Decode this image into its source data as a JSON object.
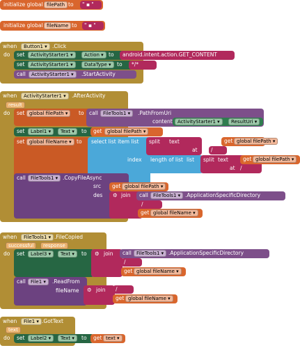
{
  "globals": [
    {
      "keyword": "initialize global",
      "name": "filePath",
      "to": "to",
      "value": " \" ▪ \" "
    },
    {
      "keyword": "initialize global",
      "name": "fileName",
      "to": "to",
      "value": " \" ▪ \" "
    }
  ],
  "ev1": {
    "when": "when",
    "component": "Button1 ▾",
    "event": ".Click",
    "do": "do",
    "set": "set",
    "c1": "ActivityStarter1 ▾",
    "p1": "Action ▾",
    "to": "to",
    "v1": "android.intent.action.GET_CONTENT",
    "c2": "ActivityStarter1 ▾",
    "p2": "DataType ▾",
    "v2": "*/*",
    "call": "call",
    "c3": "ActivityStarter1 ▾",
    "m3": ".StartActivity"
  },
  "ev2": {
    "when": "when",
    "component": "ActivityStarter1 ▾",
    "event": ".AfterActivity",
    "param": "result",
    "do": "do",
    "set": "set",
    "g1": "global filePath ▾",
    "to": "to",
    "call": "call",
    "ft": "FileTools1 ▾",
    "path": ".PathFromUri",
    "contentUri": "contentUri",
    "as": "ActivityStarter1 ▾",
    "resultUri": "ResultUri ▾",
    "lbl": "Label1 ▾",
    "txt": "Text ▾",
    "get": "get",
    "gfp": "global filePath ▾",
    "gfn": "global fileName ▾",
    "select": "select list item  list",
    "split": "split",
    "text": "text",
    "at": "at",
    "slash": "/",
    "index": "index",
    "length": "length of list",
    "list": "list",
    "copy": ".CopyFileAsync",
    "src": "src",
    "des": "des",
    "join": "join",
    "appdir": ".ApplicationSpecificDirectory",
    "gfn2": "global fileName ▾"
  },
  "ev3": {
    "when": "when",
    "component": "FileTools1 ▾",
    "event": ".FileCopied",
    "p1": "successful",
    "p2": "response",
    "do": "do",
    "set": "set",
    "lbl": "Label3 ▾",
    "txt": "Text ▾",
    "to": "to",
    "join": "join",
    "call": "call",
    "ft": "FileTools1 ▾",
    "appdir": ".ApplicationSpecificDirectory",
    "slash": "/",
    "get": "get",
    "gfn": "global fileName ▾",
    "file": "File1 ▾",
    "read": ".ReadFrom",
    "fileName": "fileName"
  },
  "ev4": {
    "when": "when",
    "component": "File1 ▾",
    "event": ".GotText",
    "param": "text",
    "do": "do",
    "set": "set",
    "lbl": "Label2 ▾",
    "txt": "Text ▾",
    "to": "to",
    "get": "get",
    "val": "text ▾"
  }
}
